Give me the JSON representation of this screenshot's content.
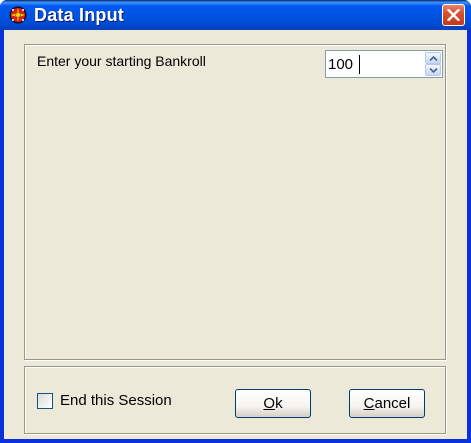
{
  "window": {
    "title": "Data Input",
    "icon": "roulette-wheel-icon",
    "close_icon": "close-icon"
  },
  "main": {
    "prompt": "Enter your starting Bankroll",
    "bankroll_value": "100"
  },
  "footer": {
    "checkbox_label": "End this Session",
    "checkbox_checked": false,
    "ok_mnemonic": "O",
    "ok_rest": "k",
    "cancel_mnemonic": "C",
    "cancel_rest": "ancel"
  },
  "colors": {
    "title_bar": "#0054e3",
    "dialog_bg": "#ece9d8",
    "close_button": "#d8512f"
  }
}
